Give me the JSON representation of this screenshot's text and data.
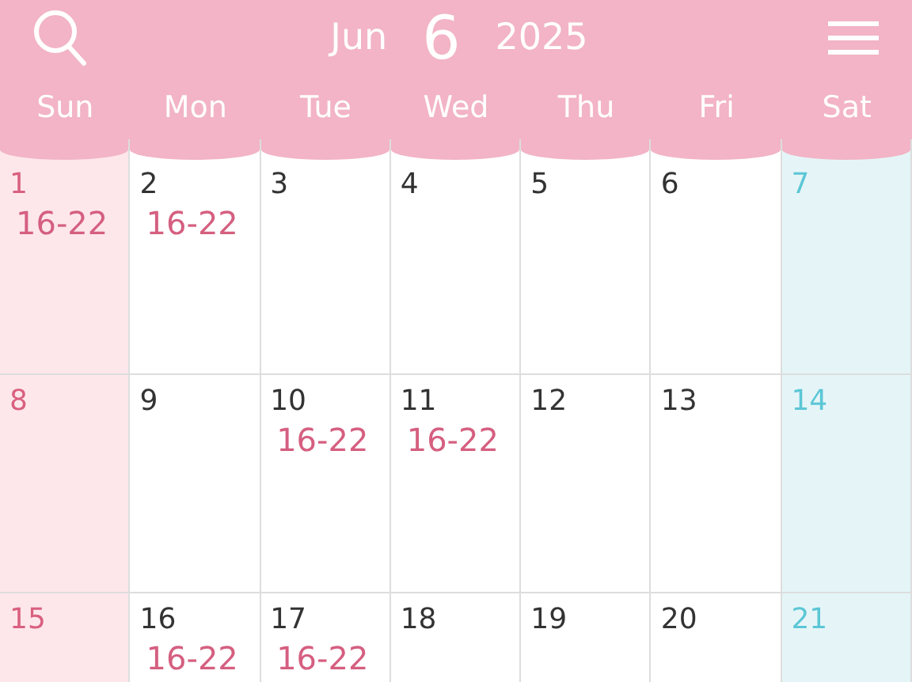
{
  "header": {
    "month": "Jun",
    "month_number": "6",
    "year": "2025"
  },
  "weekdays": [
    "Sun",
    "Mon",
    "Tue",
    "Wed",
    "Thu",
    "Fri",
    "Sat"
  ],
  "weeks": [
    [
      {
        "day": "1",
        "shift": "16-22"
      },
      {
        "day": "2",
        "shift": "16-22"
      },
      {
        "day": "3"
      },
      {
        "day": "4"
      },
      {
        "day": "5"
      },
      {
        "day": "6"
      },
      {
        "day": "7"
      }
    ],
    [
      {
        "day": "8"
      },
      {
        "day": "9"
      },
      {
        "day": "10",
        "shift": "16-22"
      },
      {
        "day": "11",
        "shift": "16-22"
      },
      {
        "day": "12"
      },
      {
        "day": "13"
      },
      {
        "day": "14"
      }
    ],
    [
      {
        "day": "15"
      },
      {
        "day": "16",
        "shift": "16-22"
      },
      {
        "day": "17",
        "shift": "16-22"
      },
      {
        "day": "18"
      },
      {
        "day": "19"
      },
      {
        "day": "20"
      },
      {
        "day": "21"
      }
    ]
  ]
}
